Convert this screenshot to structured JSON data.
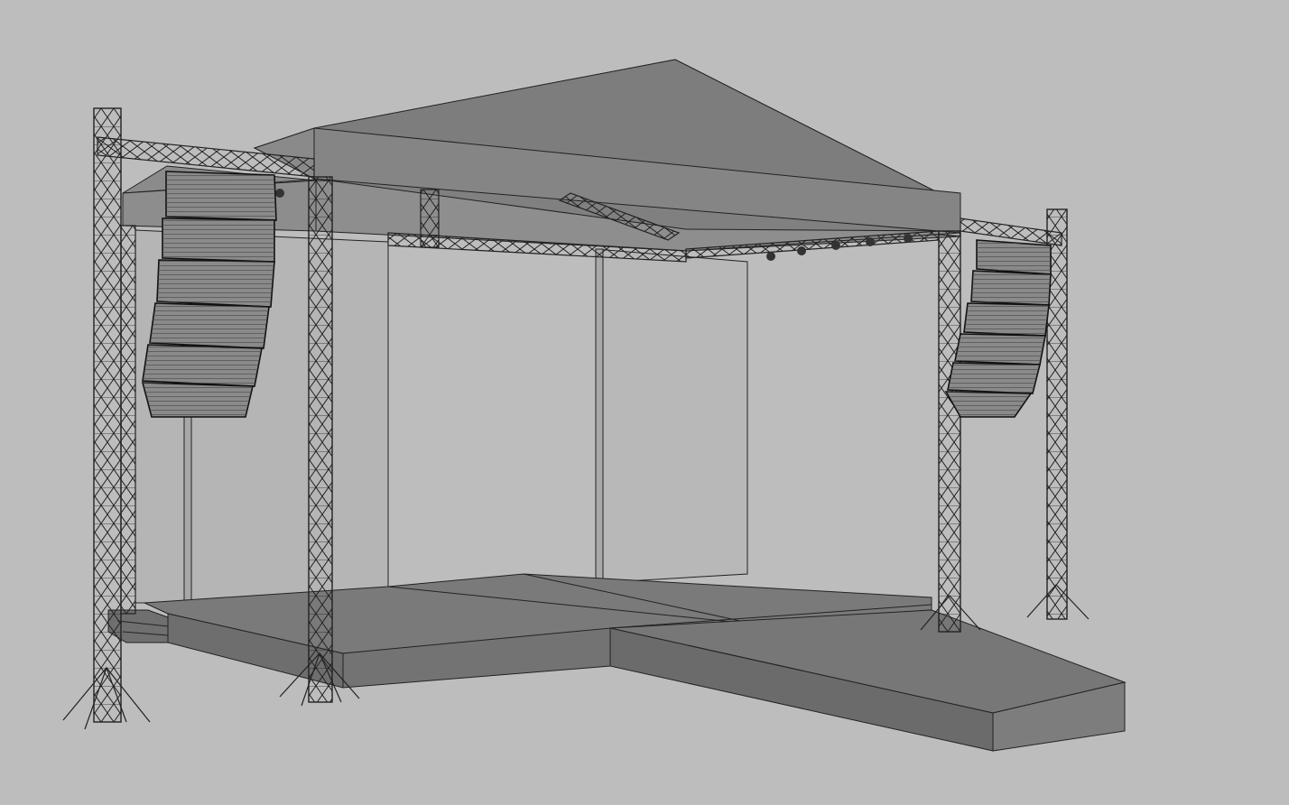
{
  "scene": {
    "subject": "stage-model",
    "colors": {
      "background": "#bdbdbd",
      "roof_top": "#7f7f7f",
      "roof_front": "#858585",
      "roof_underside": "#8e8e8e",
      "wall": "#b7b7b7",
      "wall_side": "#aaaaaa",
      "deck_top": "#7a7a7a",
      "deck_front": "#6f6f6f",
      "speaker": "#8a8a8a",
      "line": "#1a1a1a"
    },
    "icons": [
      "truss-column",
      "truss-beam",
      "line-array-speaker",
      "spotlight",
      "stage-deck",
      "roof-canopy"
    ]
  }
}
